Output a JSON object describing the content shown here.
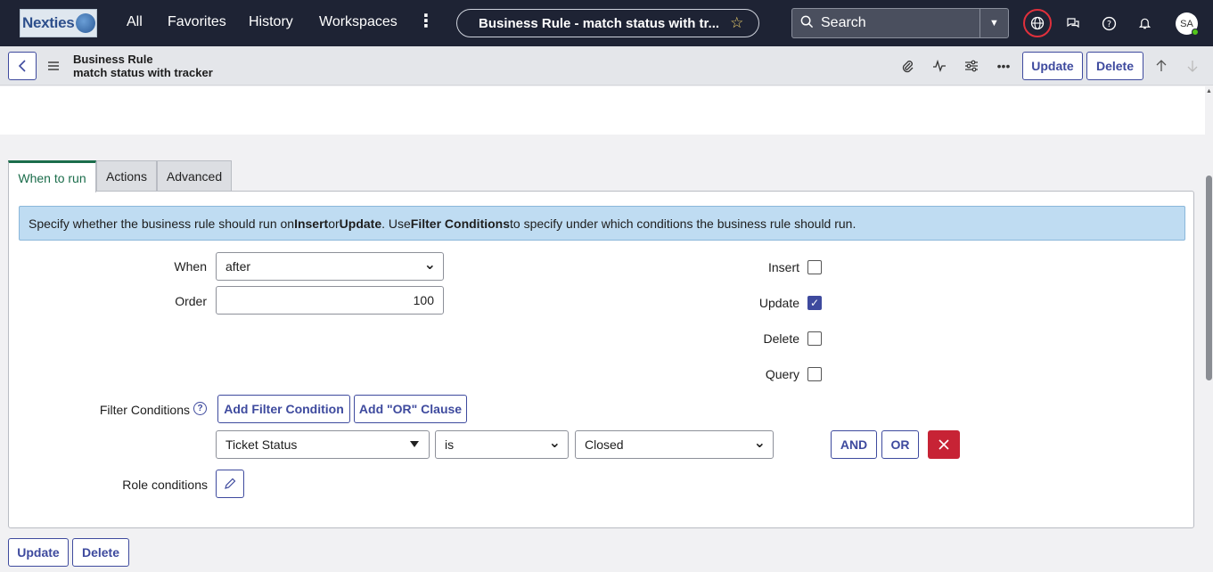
{
  "topnav": {
    "logo_text": "Nexties",
    "links": [
      "All",
      "Favorites",
      "History",
      "Workspaces"
    ],
    "more_icon": "vertical-ellipsis-icon",
    "record_title": "Business Rule - match status with tr...",
    "search_placeholder": "Search",
    "user_initials": "SA"
  },
  "form_header": {
    "record_type": "Business Rule",
    "record_name": "match status with tracker",
    "update_label": "Update",
    "delete_label": "Delete"
  },
  "tabs": [
    {
      "label": "When to run",
      "active": true
    },
    {
      "label": "Actions",
      "active": false
    },
    {
      "label": "Advanced",
      "active": false
    }
  ],
  "info": {
    "t1": "Specify whether the business rule should run on ",
    "b1": "Insert",
    "t2": " or ",
    "b2": "Update",
    "t3": ". Use ",
    "b3": "Filter Conditions",
    "t4": " to specify under which conditions the business rule should run."
  },
  "form": {
    "when_label": "When",
    "when_value": "after",
    "order_label": "Order",
    "order_value": "100",
    "insert_label": "Insert",
    "insert_checked": false,
    "update_label": "Update",
    "update_checked": true,
    "delete_label": "Delete",
    "delete_checked": false,
    "query_label": "Query",
    "query_checked": false,
    "filter_conditions_label": "Filter Conditions",
    "add_filter_label": "Add Filter Condition",
    "add_or_label": "Add \"OR\" Clause",
    "condition": {
      "field": "Ticket Status",
      "operator": "is",
      "value": "Closed"
    },
    "and_label": "AND",
    "or_label": "OR",
    "role_conditions_label": "Role conditions"
  },
  "footer": {
    "update_label": "Update",
    "delete_label": "Delete"
  },
  "colors": {
    "nav_bg": "#1e2334",
    "accent": "#3e4a9e",
    "active_tab": "#1b6d4b",
    "info_bg": "#bfdcf2",
    "danger": "#c72335"
  }
}
